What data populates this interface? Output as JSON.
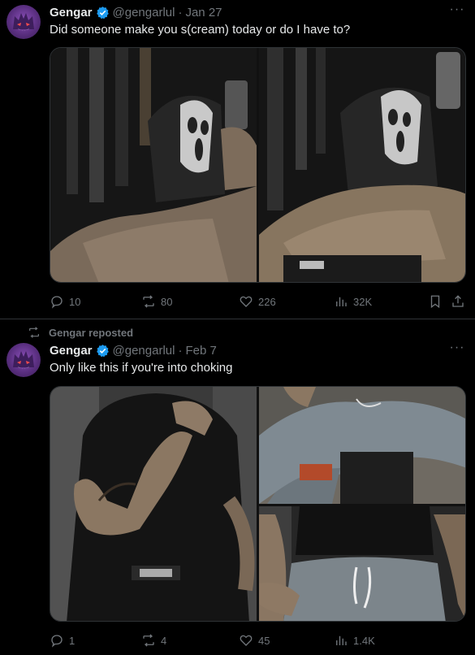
{
  "posts": [
    {
      "author": {
        "name": "Gengar",
        "handle": "@gengarlul",
        "verified": true
      },
      "date": "Jan 27",
      "dot": "·",
      "text": "Did someone make you s(cream) today or do I have to?",
      "media": [
        {
          "icon": "masked-figure-mirror-selfie-photo"
        },
        {
          "icon": "masked-figure-mirror-selfie-photo"
        }
      ],
      "actions": {
        "replies": "10",
        "reposts": "80",
        "likes": "226",
        "views": "32K"
      }
    },
    {
      "repost_label": "Gengar reposted",
      "author": {
        "name": "Gengar",
        "handle": "@gengarlul",
        "verified": true
      },
      "date": "Feb 7",
      "dot": "·",
      "text": "Only like this if you're into choking",
      "media": [
        {
          "icon": "black-shirt-torso-photo"
        },
        {
          "icon": "grey-sweatpants-seated-photo"
        },
        {
          "icon": "black-shirt-seated-photo"
        }
      ],
      "actions": {
        "replies": "1",
        "reposts": "4",
        "likes": "45",
        "views": "1.4K"
      }
    }
  ],
  "colors": {
    "background": "#000000",
    "text": "#e7e9ea",
    "muted": "#71767b",
    "verified": "#1d9bf0",
    "border": "#2f3336"
  }
}
